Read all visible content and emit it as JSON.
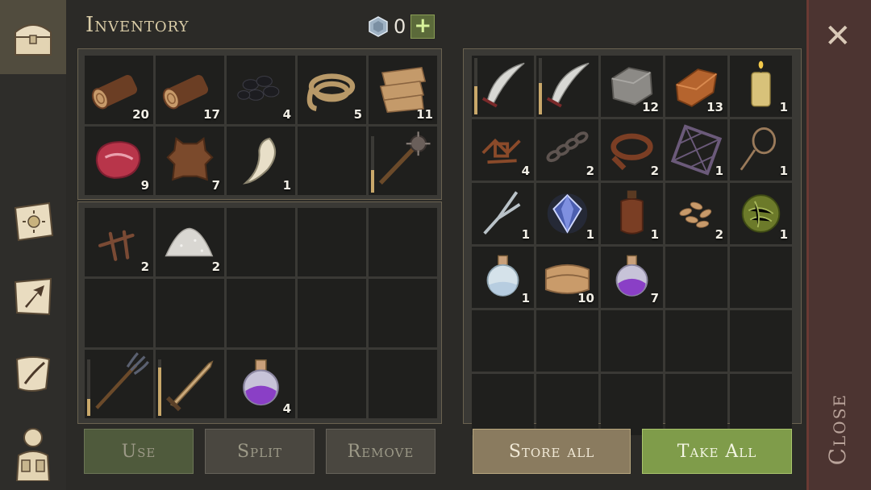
{
  "header": {
    "title": "Inventory",
    "currency_value": "0",
    "plus_label": "+"
  },
  "sidebar": {
    "tabs": [
      {
        "name": "chest-icon",
        "active": true
      },
      {
        "name": "sun-book-icon",
        "active": false
      },
      {
        "name": "map-arrow-icon",
        "active": false
      },
      {
        "name": "scroll-quill-icon",
        "active": false
      },
      {
        "name": "character-equipment-icon",
        "active": false
      }
    ]
  },
  "left": {
    "top_grid": [
      {
        "icon": "log",
        "count": "20"
      },
      {
        "icon": "log",
        "count": "17"
      },
      {
        "icon": "coal",
        "count": "4"
      },
      {
        "icon": "rope",
        "count": "5"
      },
      {
        "icon": "cloth-strips",
        "count": "11"
      },
      {
        "icon": "raw-meat",
        "count": "9"
      },
      {
        "icon": "leather-hide",
        "count": "7"
      },
      {
        "icon": "fang",
        "count": "1"
      },
      {
        "icon": "",
        "count": ""
      },
      {
        "icon": "spiked-mace",
        "count": "",
        "durability": 0.4
      }
    ],
    "bottom_grid": [
      {
        "icon": "nails",
        "count": "2"
      },
      {
        "icon": "salt-pile",
        "count": "2"
      },
      {
        "icon": "",
        "count": ""
      },
      {
        "icon": "",
        "count": ""
      },
      {
        "icon": "",
        "count": ""
      },
      {
        "icon": "",
        "count": ""
      },
      {
        "icon": "",
        "count": ""
      },
      {
        "icon": "",
        "count": ""
      },
      {
        "icon": "",
        "count": ""
      },
      {
        "icon": "",
        "count": ""
      },
      {
        "icon": "pitchfork",
        "count": "",
        "durability": 0.3
      },
      {
        "icon": "sword",
        "count": "",
        "durability": 0.85
      },
      {
        "icon": "purple-potion",
        "count": "4"
      },
      {
        "icon": "",
        "count": ""
      },
      {
        "icon": "",
        "count": ""
      }
    ],
    "buttons": {
      "use": "Use",
      "split": "Split",
      "remove": "Remove"
    }
  },
  "right": {
    "grid": [
      {
        "icon": "scimitar",
        "count": "",
        "durability": 0.5
      },
      {
        "icon": "scimitar",
        "count": "",
        "durability": 0.55
      },
      {
        "icon": "stone-block",
        "count": "12"
      },
      {
        "icon": "copper-ingot",
        "count": "13"
      },
      {
        "icon": "candle",
        "count": "1"
      },
      {
        "icon": "scrap-metal",
        "count": "4"
      },
      {
        "icon": "chain",
        "count": "2"
      },
      {
        "icon": "leather-belt",
        "count": "2"
      },
      {
        "icon": "grate",
        "count": "1"
      },
      {
        "icon": "lasso",
        "count": "1"
      },
      {
        "icon": "tuning-fork",
        "count": "1"
      },
      {
        "icon": "blue-crystal",
        "count": "1"
      },
      {
        "icon": "leather-flask",
        "count": "1"
      },
      {
        "icon": "seeds",
        "count": "2"
      },
      {
        "icon": "herb-ball",
        "count": "1"
      },
      {
        "icon": "water-potion",
        "count": "1"
      },
      {
        "icon": "folded-cloth",
        "count": "10"
      },
      {
        "icon": "purple-potion",
        "count": "7"
      },
      {
        "icon": "",
        "count": ""
      },
      {
        "icon": "",
        "count": ""
      },
      {
        "icon": "",
        "count": ""
      },
      {
        "icon": "",
        "count": ""
      },
      {
        "icon": "",
        "count": ""
      },
      {
        "icon": "",
        "count": ""
      },
      {
        "icon": "",
        "count": ""
      },
      {
        "icon": "",
        "count": ""
      },
      {
        "icon": "",
        "count": ""
      },
      {
        "icon": "",
        "count": ""
      },
      {
        "icon": "",
        "count": ""
      },
      {
        "icon": "",
        "count": ""
      }
    ],
    "buttons": {
      "store_all": "Store all",
      "take_all": "Take All"
    }
  },
  "close": {
    "x": "✕",
    "label": "Close"
  },
  "colors": {
    "accent_green": "#7f9c4a",
    "gold": "#c9a86a",
    "panel": "#3a3935",
    "slot": "#1f1f1d"
  }
}
